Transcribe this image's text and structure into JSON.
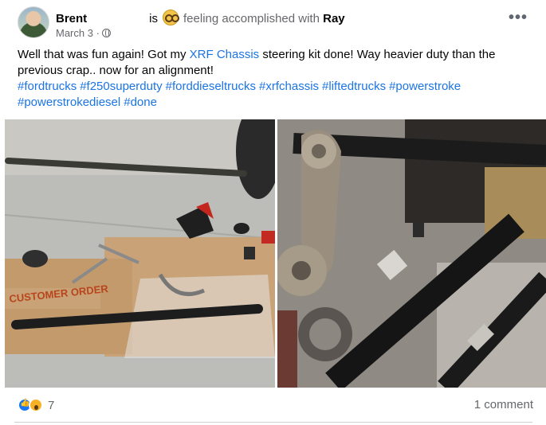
{
  "header": {
    "author": "Brent",
    "is_text": "is",
    "feeling": "feeling accomplished with",
    "tagged": "Ray",
    "date": "March 3 ·",
    "more_label": "•••"
  },
  "post": {
    "text_before": "Well that was fun again! Got my ",
    "link_text": "XRF Chassis",
    "text_after": " steering kit done! Way heavier duty than the previous crap.. now for an alignment!",
    "hashtags": [
      "#fordtrucks",
      "#f250superduty",
      "#forddieseltrucks",
      "#xrfchassis",
      "#liftedtrucks",
      "#powerstroke",
      "#powerstrokediesel",
      "#done"
    ]
  },
  "photos": {
    "left_box_text": "CUSTOMER ORDER"
  },
  "footer": {
    "reaction_count": "7",
    "comment_count": "1 comment"
  },
  "colors": {
    "link": "#1b74e4",
    "secondary_text": "#65676b",
    "like_blue": "#1877f2",
    "wow_yellow": "#f7b125"
  }
}
